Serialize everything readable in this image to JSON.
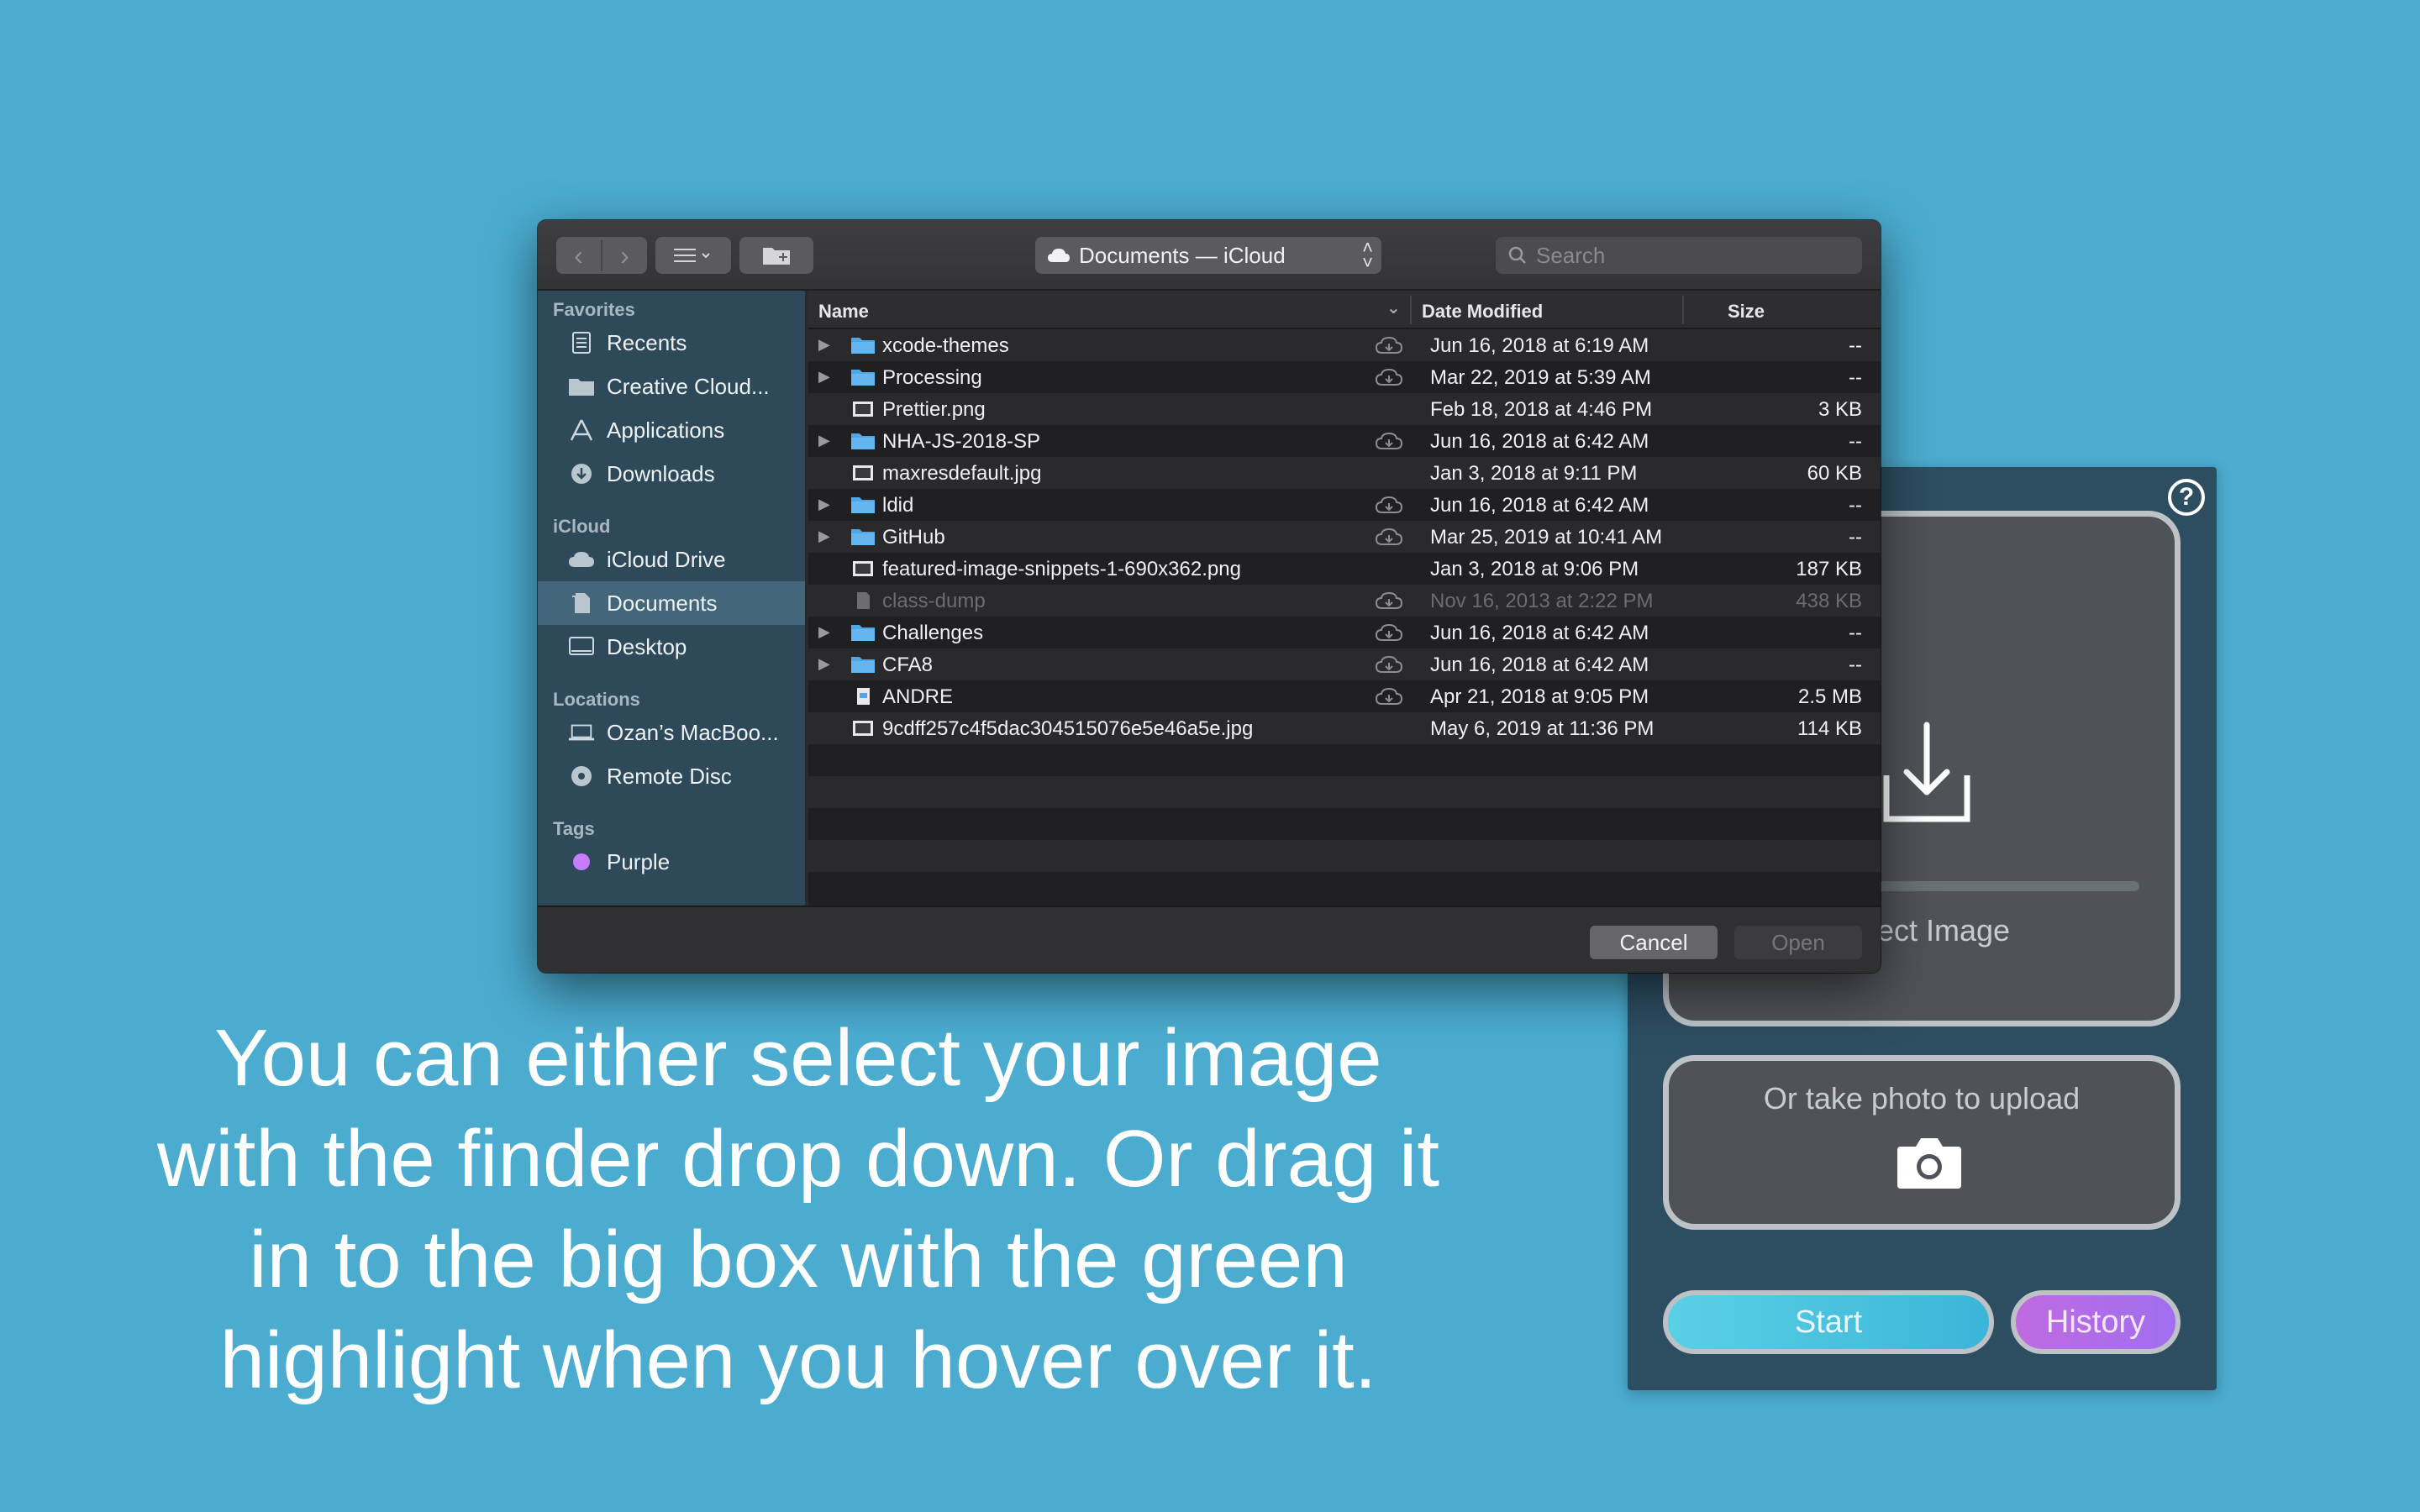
{
  "app": {
    "help_icon": "question-mark-icon",
    "drop_label": "Select Image",
    "drop_progress": 0,
    "photo_label": "Or take photo to upload",
    "start_label": "Start",
    "history_label": "History",
    "colors": {
      "background": "#4bacd0",
      "panel": "#2d4d61",
      "start": "#3bb5d8",
      "history": "#b06ce8"
    }
  },
  "caption": "You can either select your image with the finder drop down. Or drag it in to the big box with the green highlight when you hover over it.",
  "dialog": {
    "location": "Documents — iCloud",
    "search_placeholder": "Search",
    "columns": {
      "name": "Name",
      "date": "Date Modified",
      "size": "Size"
    },
    "sidebar": {
      "favorites_label": "Favorites",
      "favorites": [
        {
          "label": "Recents",
          "icon": "recents-icon"
        },
        {
          "label": "Creative Cloud...",
          "icon": "folder-icon"
        },
        {
          "label": "Applications",
          "icon": "applications-icon"
        },
        {
          "label": "Downloads",
          "icon": "downloads-icon"
        }
      ],
      "icloud_label": "iCloud",
      "icloud": [
        {
          "label": "iCloud Drive",
          "icon": "cloud-icon"
        },
        {
          "label": "Documents",
          "icon": "documents-icon",
          "selected": true
        },
        {
          "label": "Desktop",
          "icon": "desktop-icon"
        }
      ],
      "locations_label": "Locations",
      "locations": [
        {
          "label": "Ozan’s MacBoo...",
          "icon": "laptop-icon"
        },
        {
          "label": "Remote Disc",
          "icon": "disc-icon"
        }
      ],
      "tags_label": "Tags",
      "tags": [
        {
          "label": "Purple",
          "color": "#c77dff"
        }
      ]
    },
    "files": [
      {
        "name": "xcode-themes",
        "type": "folder",
        "cloud": true,
        "date": "Jun 16, 2018 at 6:19 AM",
        "size": "--"
      },
      {
        "name": "Processing",
        "type": "folder",
        "cloud": true,
        "date": "Mar 22, 2019 at 5:39 AM",
        "size": "--"
      },
      {
        "name": "Prettier.png",
        "type": "image",
        "cloud": false,
        "date": "Feb 18, 2018 at 4:46 PM",
        "size": "3 KB"
      },
      {
        "name": "NHA-JS-2018-SP",
        "type": "folder",
        "cloud": true,
        "date": "Jun 16, 2018 at 6:42 AM",
        "size": "--"
      },
      {
        "name": "maxresdefault.jpg",
        "type": "image",
        "cloud": false,
        "date": "Jan 3, 2018 at 9:11 PM",
        "size": "60 KB"
      },
      {
        "name": "ldid",
        "type": "folder",
        "cloud": true,
        "date": "Jun 16, 2018 at 6:42 AM",
        "size": "--"
      },
      {
        "name": "GitHub",
        "type": "folder",
        "cloud": true,
        "date": "Mar 25, 2019 at 10:41 AM",
        "size": "--"
      },
      {
        "name": "featured-image-snippets-1-690x362.png",
        "type": "image",
        "cloud": false,
        "date": "Jan 3, 2018 at 9:06 PM",
        "size": "187 KB"
      },
      {
        "name": "class-dump",
        "type": "file",
        "cloud": true,
        "dim": true,
        "date": "Nov 16, 2013 at 2:22 PM",
        "size": "438 KB"
      },
      {
        "name": "Challenges",
        "type": "folder",
        "cloud": true,
        "date": "Jun 16, 2018 at 6:42 AM",
        "size": "--"
      },
      {
        "name": "CFA8",
        "type": "folder",
        "cloud": true,
        "date": "Jun 16, 2018 at 6:42 AM",
        "size": "--"
      },
      {
        "name": "ANDRE",
        "type": "doc",
        "cloud": true,
        "date": "Apr 21, 2018 at 9:05 PM",
        "size": "2.5 MB"
      },
      {
        "name": "9cdff257c4f5dac304515076e5e46a5e.jpg",
        "type": "image",
        "cloud": false,
        "date": "May 6, 2019 at 11:36 PM",
        "size": "114 KB"
      }
    ],
    "cancel_label": "Cancel",
    "open_label": "Open"
  }
}
